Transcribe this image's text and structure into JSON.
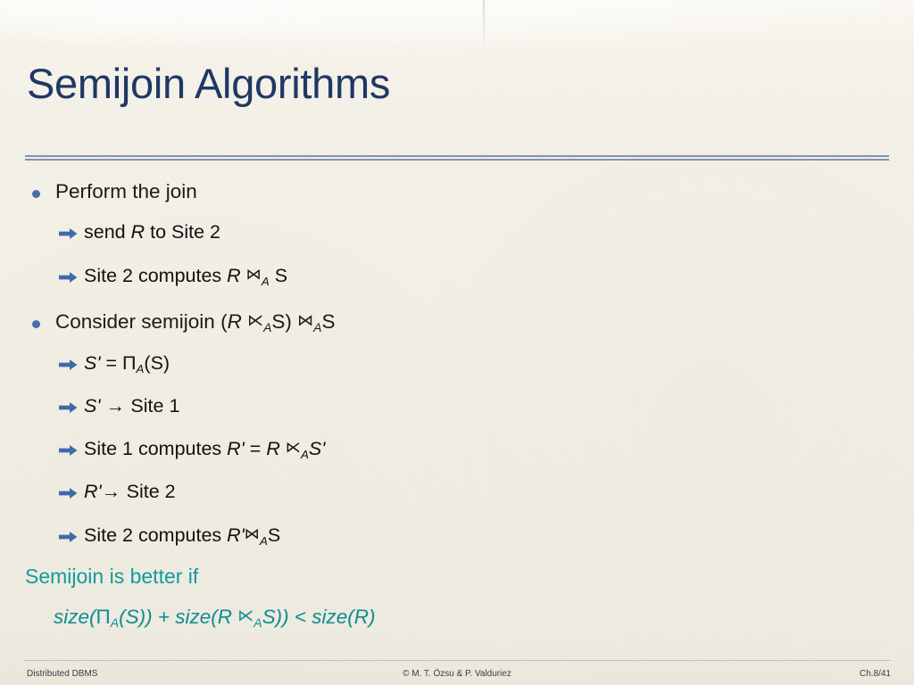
{
  "slide": {
    "title": "Semijoin Algorithms",
    "title_color": "#1f3864",
    "rule_color": "#7f93b5",
    "background_color": "#f2efe6",
    "bullet_color": "#4a6ea8",
    "accent_teal": "#119b9b"
  },
  "content": {
    "bullets": [
      {
        "label": "Perform the join",
        "sub": [
          {
            "text": "send R to Site 2",
            "parts": "send |R| to Site 2"
          },
          {
            "text": "Site 2 computes R ⋈A S",
            "parts": "Site 2 computes |R| ⋈ A |S|"
          }
        ]
      },
      {
        "label": "Consider semijoin (R ⋉A S) ⋈A S",
        "sub": [
          {
            "text": "S' = ΠA(S)"
          },
          {
            "text": "S' → Site 1"
          },
          {
            "text": "Site 1 computes R' = R ⋉A S'"
          },
          {
            "text": "R' → Site 2"
          },
          {
            "text": "Site 2 computes R' ⋈A S"
          }
        ]
      }
    ],
    "conclusion_heading": "Semijoin is better if",
    "conclusion_formula": "size(ΠA(S)) + size(R ⋉A S)) < size(R)"
  },
  "symbols": {
    "join": "⋈",
    "semijoin": "⋉",
    "projection": "Π",
    "arrow_right": "→",
    "subscript_attr": "A",
    "bullet_marker": "bullet-dot",
    "sub_marker": "arrow-right-marker"
  },
  "text": {
    "perform_the_join": "Perform the join",
    "send": "send",
    "to_site_2": "to Site 2",
    "site2_computes": "Site 2 computes",
    "consider_semijoin": "Consider semijoin",
    "site1_computes": "Site 1 computes",
    "equals": "=",
    "site_1": "Site 1",
    "site_2": "Site 2",
    "R": "R",
    "S": "S",
    "Rprime": "R'",
    "Sprime": "S'",
    "plus": "+",
    "less_than": "<",
    "size": "size"
  },
  "footer": {
    "left": "Distributed DBMS",
    "center": "© M. T. Özsu & P. Valduriez",
    "right": "Ch.8/41"
  }
}
